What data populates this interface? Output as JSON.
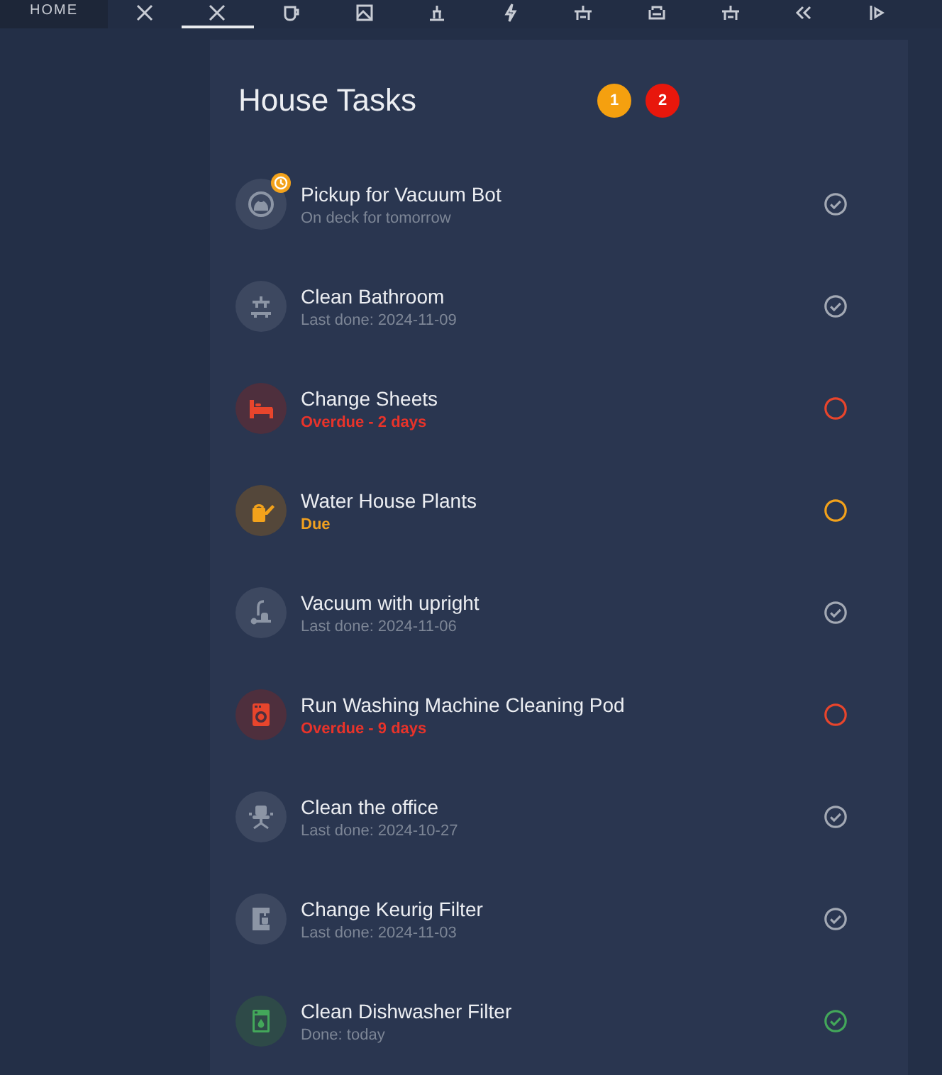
{
  "tabs": [
    {
      "label": "HOME",
      "selected": false
    },
    {
      "selected": false
    },
    {
      "selected": true
    },
    {
      "selected": false
    },
    {
      "selected": false
    },
    {
      "selected": false
    },
    {
      "selected": false
    },
    {
      "selected": false
    },
    {
      "selected": false
    },
    {
      "selected": false
    },
    {
      "selected": false
    },
    {
      "selected": false
    }
  ],
  "card": {
    "title": "House Tasks",
    "badges": [
      {
        "text": "1",
        "color": "#f5a00f"
      },
      {
        "text": "2",
        "color": "#e8170c"
      }
    ],
    "tasks": [
      {
        "title": "Pickup for Vacuum Bot",
        "subtitle": "On deck for tomorrow",
        "kind": "ok",
        "scheduled": true
      },
      {
        "title": "Clean Bathroom",
        "subtitle": "Last done: 2024-11-09",
        "kind": "ok",
        "scheduled": false
      },
      {
        "title": "Change Sheets",
        "subtitle": "Overdue - 2 days",
        "kind": "overdue",
        "scheduled": false
      },
      {
        "title": "Water House Plants",
        "subtitle": "Due",
        "kind": "due",
        "scheduled": false
      },
      {
        "title": "Vacuum with upright",
        "subtitle": "Last done: 2024-11-06",
        "kind": "ok",
        "scheduled": false
      },
      {
        "title": "Run Washing Machine Cleaning Pod",
        "subtitle": "Overdue - 9 days",
        "kind": "overdue",
        "scheduled": false
      },
      {
        "title": "Clean the office",
        "subtitle": "Last done: 2024-10-27",
        "kind": "ok",
        "scheduled": false
      },
      {
        "title": "Change Keurig Filter",
        "subtitle": "Last done: 2024-11-03",
        "kind": "ok",
        "scheduled": false
      },
      {
        "title": "Clean Dishwasher Filter",
        "subtitle": "Done: today",
        "kind": "done",
        "scheduled": false
      }
    ]
  }
}
